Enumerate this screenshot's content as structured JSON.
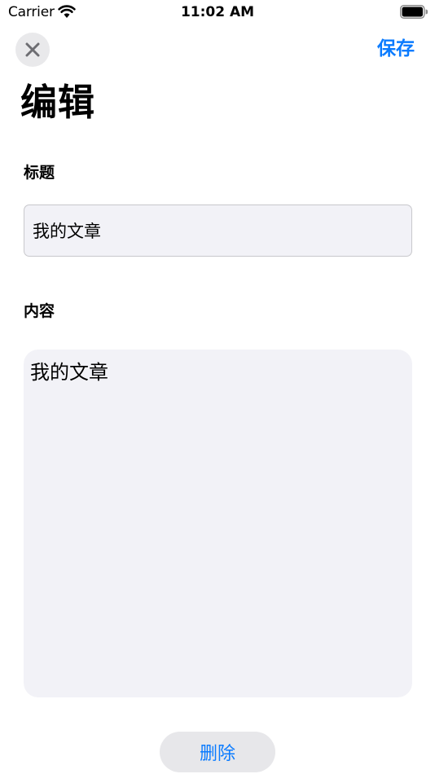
{
  "status_bar": {
    "carrier": "Carrier",
    "time": "11:02 AM",
    "wifi_icon": "wifi-icon",
    "battery_icon": "battery-icon"
  },
  "nav": {
    "close_icon": "close-icon",
    "save_label": "保存"
  },
  "page": {
    "title": "编辑"
  },
  "form": {
    "title_label": "标题",
    "title_value": "我的文章",
    "content_label": "内容",
    "content_value": "我的文章"
  },
  "actions": {
    "delete_label": "删除"
  },
  "colors": {
    "accent": "#0a7bff",
    "field_background": "#f2f2f7",
    "button_background": "#e7e7ea"
  }
}
